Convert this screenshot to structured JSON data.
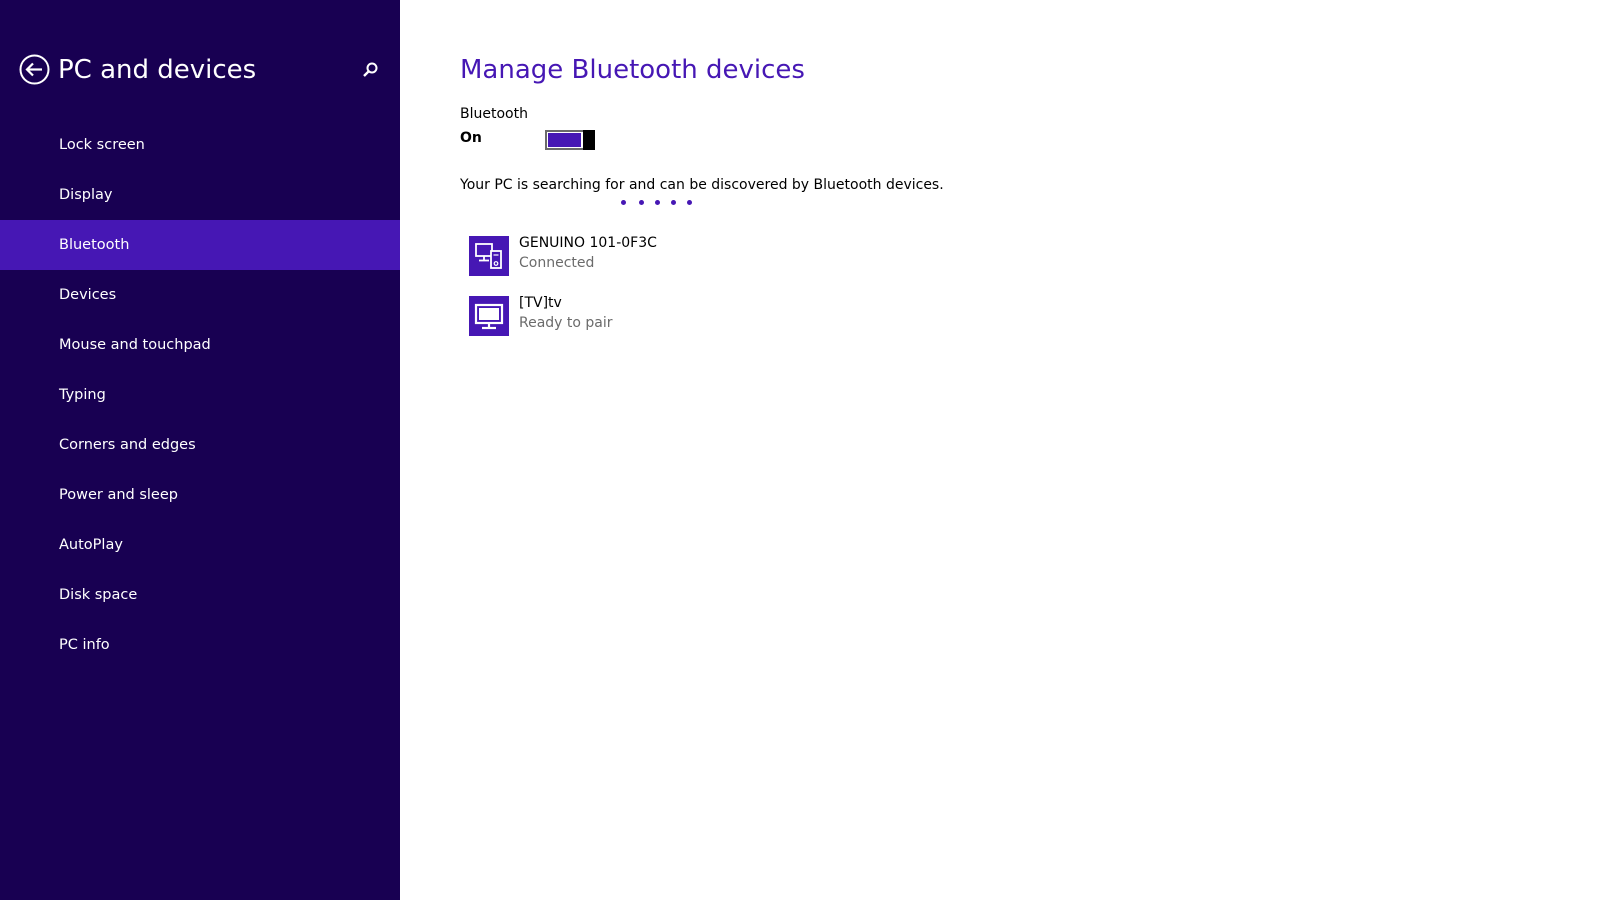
{
  "sidebar": {
    "title": "PC and devices",
    "back_icon": "back-arrow-icon",
    "search_icon": "search-icon",
    "items": [
      {
        "label": "Lock screen",
        "selected": false
      },
      {
        "label": "Display",
        "selected": false
      },
      {
        "label": "Bluetooth",
        "selected": true
      },
      {
        "label": "Devices",
        "selected": false
      },
      {
        "label": "Mouse and touchpad",
        "selected": false
      },
      {
        "label": "Typing",
        "selected": false
      },
      {
        "label": "Corners and edges",
        "selected": false
      },
      {
        "label": "Power and sleep",
        "selected": false
      },
      {
        "label": "AutoPlay",
        "selected": false
      },
      {
        "label": "Disk space",
        "selected": false
      },
      {
        "label": "PC info",
        "selected": false
      }
    ]
  },
  "main": {
    "title": "Manage Bluetooth devices",
    "bluetooth": {
      "label": "Bluetooth",
      "state": "On",
      "enabled": true
    },
    "status_text": "Your PC is searching for and can be discovered by Bluetooth devices.",
    "devices": [
      {
        "name": "GENUINO 101-0F3C",
        "status": "Connected",
        "icon": "devices-icon"
      },
      {
        "name": "[TV]tv",
        "status": "Ready to pair",
        "icon": "monitor-icon"
      }
    ]
  },
  "colors": {
    "sidebar_bg": "#180052",
    "accent": "#4617b4",
    "secondary_text": "#6b6b6b"
  }
}
